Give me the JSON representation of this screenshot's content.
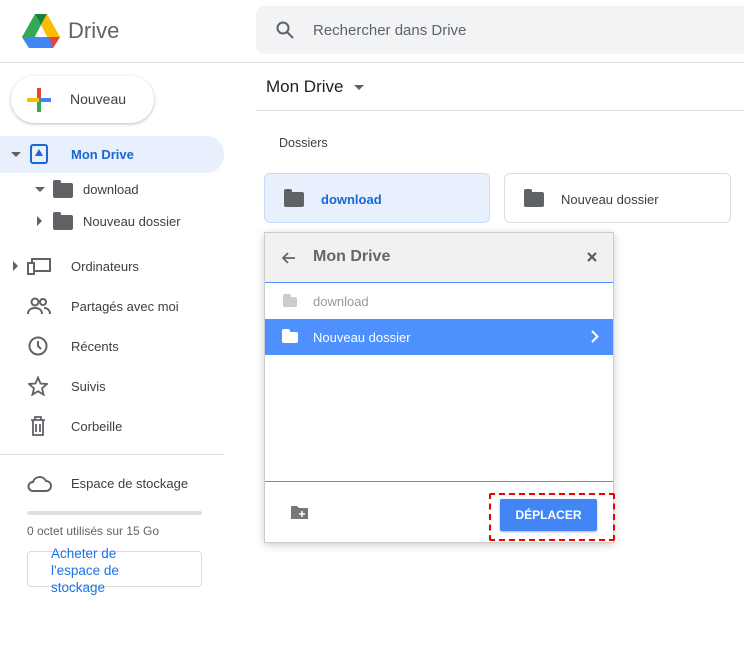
{
  "app": {
    "name": "Drive"
  },
  "search": {
    "placeholder": "Rechercher dans Drive"
  },
  "sidebar": {
    "new_label": "Nouveau",
    "items": [
      {
        "label": "Mon Drive"
      },
      {
        "label": "download"
      },
      {
        "label": "Nouveau dossier"
      },
      {
        "label": "Ordinateurs"
      },
      {
        "label": "Partagés avec moi"
      },
      {
        "label": "Récents"
      },
      {
        "label": "Suivis"
      },
      {
        "label": "Corbeille"
      }
    ],
    "storage": {
      "label": "Espace de stockage",
      "usage": "0 octet utilisés sur 15 Go",
      "used_fraction": 0,
      "buy_label": "Acheter de l'espace de stockage"
    }
  },
  "main": {
    "title": "Mon Drive",
    "section": "Dossiers",
    "folders": [
      {
        "name": "download"
      },
      {
        "name": "Nouveau dossier"
      }
    ]
  },
  "dialog": {
    "title": "Mon Drive",
    "items": [
      {
        "name": "download"
      },
      {
        "name": "Nouveau dossier"
      }
    ],
    "move_label": "DÉPLACER"
  },
  "colors": {
    "accent": "#1967d2",
    "button": "#4285f4",
    "selected": "#4d90fe",
    "highlight": "#e00000"
  }
}
